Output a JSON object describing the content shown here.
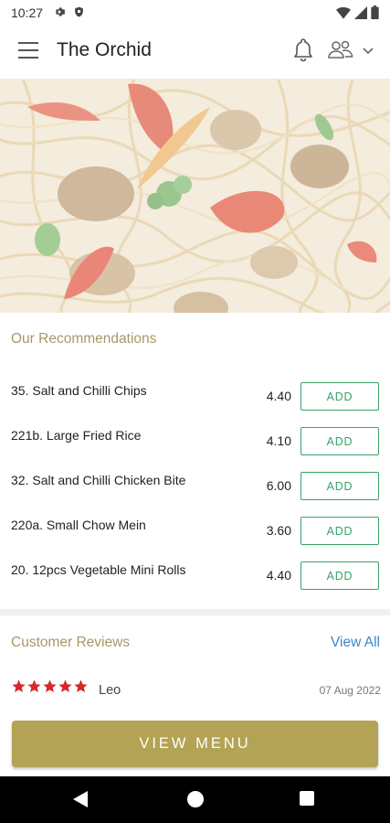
{
  "status_bar": {
    "time": "10:27"
  },
  "app_bar": {
    "title": "The Orchid"
  },
  "recommendations": {
    "title": "Our Recommendations",
    "items": [
      {
        "name": "35. Salt and Chilli Chips",
        "price": "4.40",
        "action": "ADD"
      },
      {
        "name": "221b. Large Fried Rice",
        "price": "4.10",
        "action": "ADD"
      },
      {
        "name": "32. Salt and Chilli Chicken Bite",
        "price": "6.00",
        "action": "ADD"
      },
      {
        "name": "220a. Small Chow Mein",
        "price": "3.60",
        "action": "ADD"
      },
      {
        "name": "20. 12pcs Vegetable Mini Rolls",
        "price": "4.40",
        "action": "ADD"
      }
    ]
  },
  "reviews": {
    "title": "Customer Reviews",
    "view_all": "View All",
    "items": [
      {
        "reviewer": "Leo",
        "rating": 5,
        "date": "07 Aug 2022"
      }
    ]
  },
  "footer": {
    "view_menu": "VIEW MENU"
  },
  "colors": {
    "accent_gold": "#b3a355",
    "add_green": "#3aa267",
    "link_blue": "#3b86c7",
    "star_red": "#d8262b"
  }
}
